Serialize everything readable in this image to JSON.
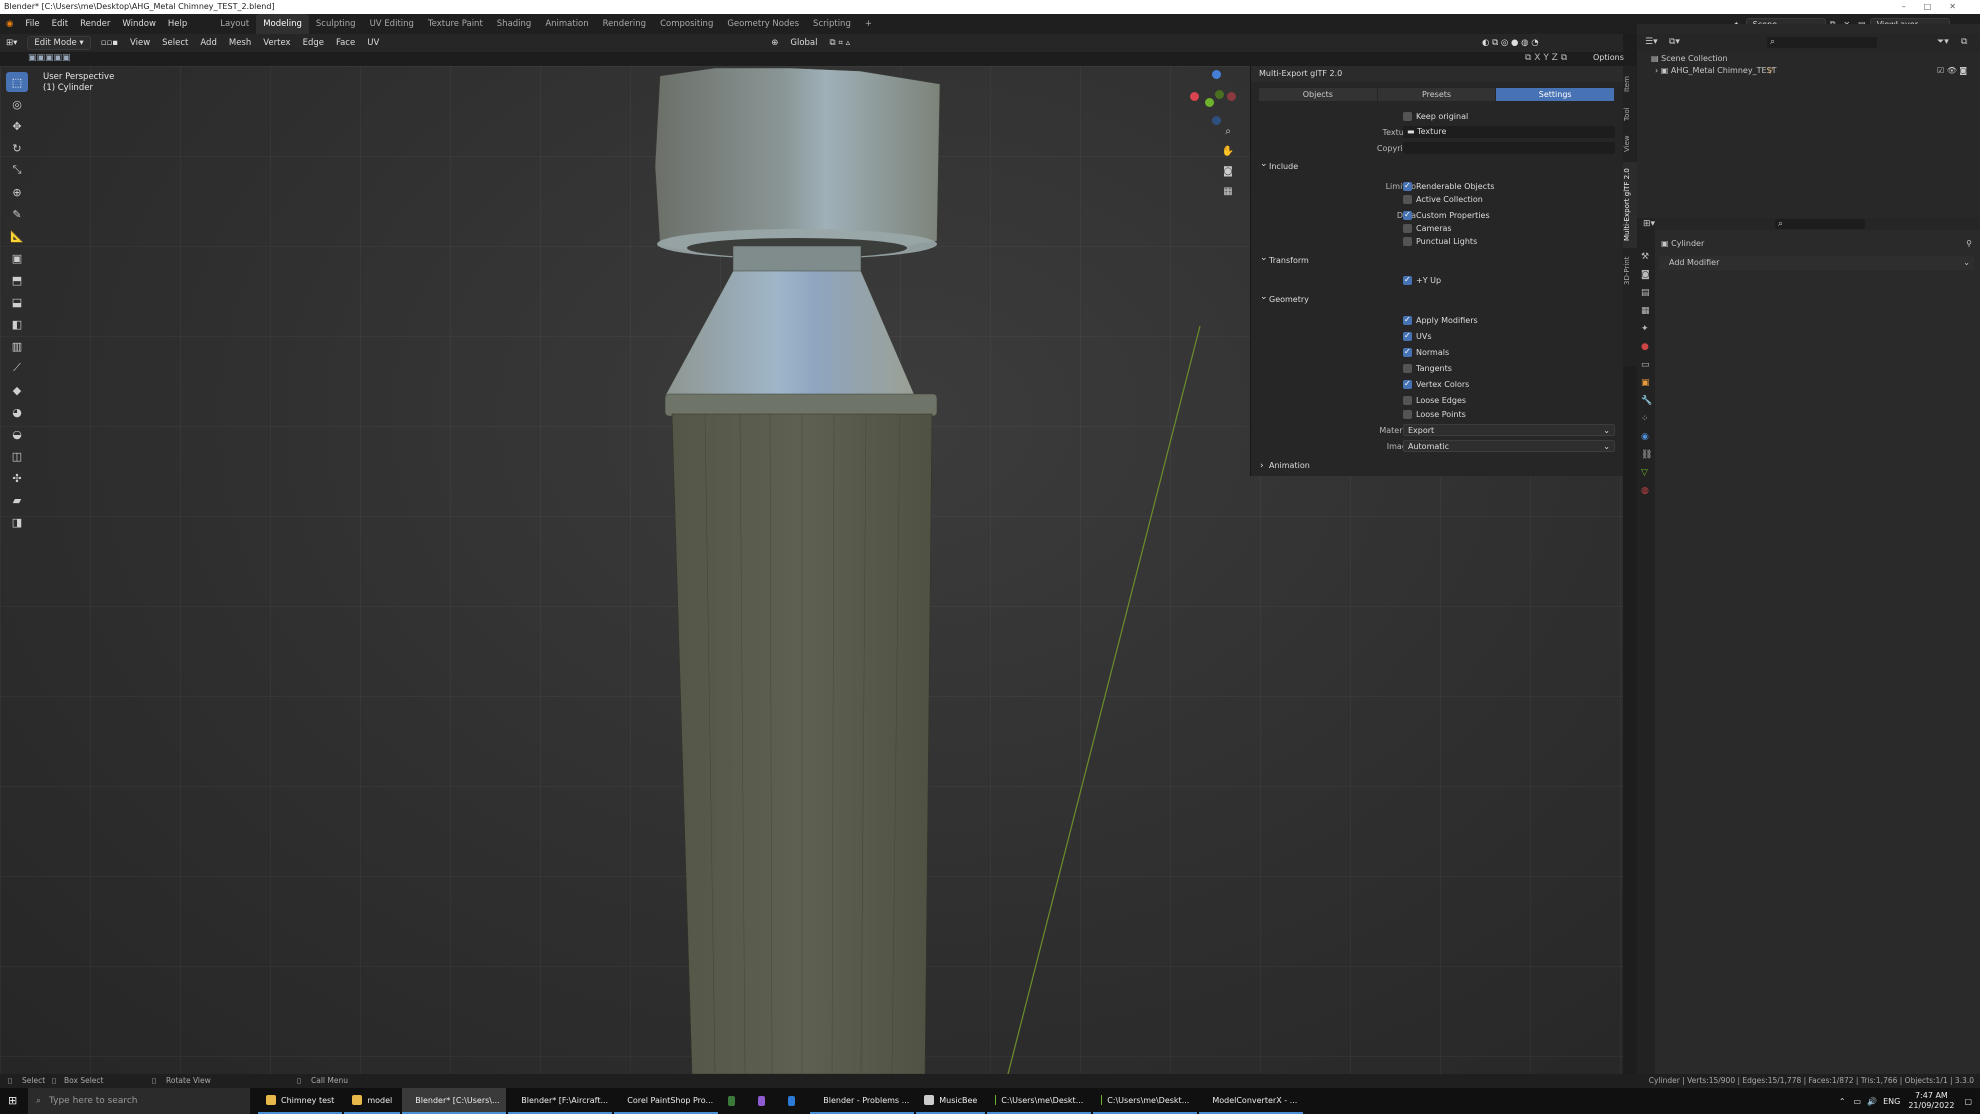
{
  "window": {
    "title": "Blender* [C:\\Users\\me\\Desktop\\AHG_Metal Chimney_TEST_2.blend]"
  },
  "menu": [
    "File",
    "Edit",
    "Render",
    "Window",
    "Help"
  ],
  "workspaces": [
    "Layout",
    "Modeling",
    "Sculpting",
    "UV Editing",
    "Texture Paint",
    "Shading",
    "Animation",
    "Rendering",
    "Compositing",
    "Geometry Nodes",
    "Scripting",
    "+"
  ],
  "active_workspace": "Modeling",
  "header": {
    "mode": "Edit Mode",
    "menus": [
      "View",
      "Select",
      "Add",
      "Mesh",
      "Vertex",
      "Edge",
      "Face",
      "UV"
    ],
    "orientation": "Global",
    "options": "Options"
  },
  "scene": {
    "scene_label": "Scene",
    "view_layer_label": "ViewLayer"
  },
  "viewport": {
    "view_name": "User Perspective",
    "object_name": "(1) Cylinder"
  },
  "npanel": {
    "title": "Multi-Export glTF 2.0",
    "tabs": [
      "Objects",
      "Presets",
      "Settings"
    ],
    "active_tab": "Settings",
    "keep_original": "Keep original",
    "textures_label": "Textures",
    "textures_value": "Texture",
    "copyright_label": "Copyright",
    "include_section": "Include",
    "limit_to_label": "Limit to",
    "renderable_objects": "Renderable Objects",
    "active_collection": "Active Collection",
    "data_label": "Data",
    "custom_properties": "Custom Properties",
    "cameras": "Cameras",
    "punctual_lights": "Punctual Lights",
    "transform_section": "Transform",
    "y_up": "+Y Up",
    "geometry_section": "Geometry",
    "apply_modifiers": "Apply Modifiers",
    "uvs": "UVs",
    "normals": "Normals",
    "tangents": "Tangents",
    "vertex_colors": "Vertex Colors",
    "loose_edges": "Loose Edges",
    "loose_points": "Loose Points",
    "materials_label": "Materials",
    "materials_value": "Export",
    "images_label": "Images",
    "images_value": "Automatic",
    "animation_section": "Animation"
  },
  "sidetabs": [
    "Item",
    "Tool",
    "View",
    "Multi-Export glTF 2.0",
    "3D-Print"
  ],
  "outliner": {
    "root": "Scene Collection",
    "item": "AHG_Metal Chimney_TEST"
  },
  "properties": {
    "object_name": "Cylinder",
    "add_modifier": "Add Modifier"
  },
  "statusbar": {
    "select": "Select",
    "box_select": "Box Select",
    "rotate_view": "Rotate View",
    "call_menu": "Call Menu",
    "stats": "Cylinder | Verts:15/900 | Edges:15/1,778 | Faces:1/872 | Tris:1,766 | Objects:1/1 | 3.3.0"
  },
  "taskbar": {
    "search_placeholder": "Type here to search",
    "items": [
      "Chimney test",
      "model",
      "Blender* [C:\\Users\\...",
      "Blender* [F:\\Aircraft...",
      "Corel PaintShop Pro...",
      "Blender - Problems ...",
      "MusicBee",
      "C:\\Users\\me\\Deskt...",
      "C:\\Users\\me\\Deskt...",
      "ModelConverterX - ..."
    ],
    "lang": "ENG",
    "time": "7:47 AM",
    "date": "21/09/2022"
  },
  "colors": {
    "accent": "#4772b3",
    "viewport_bg": "#393939",
    "x_axis": "#d9444f",
    "y_axis": "#6fb32d",
    "z_axis": "#4580d6"
  }
}
